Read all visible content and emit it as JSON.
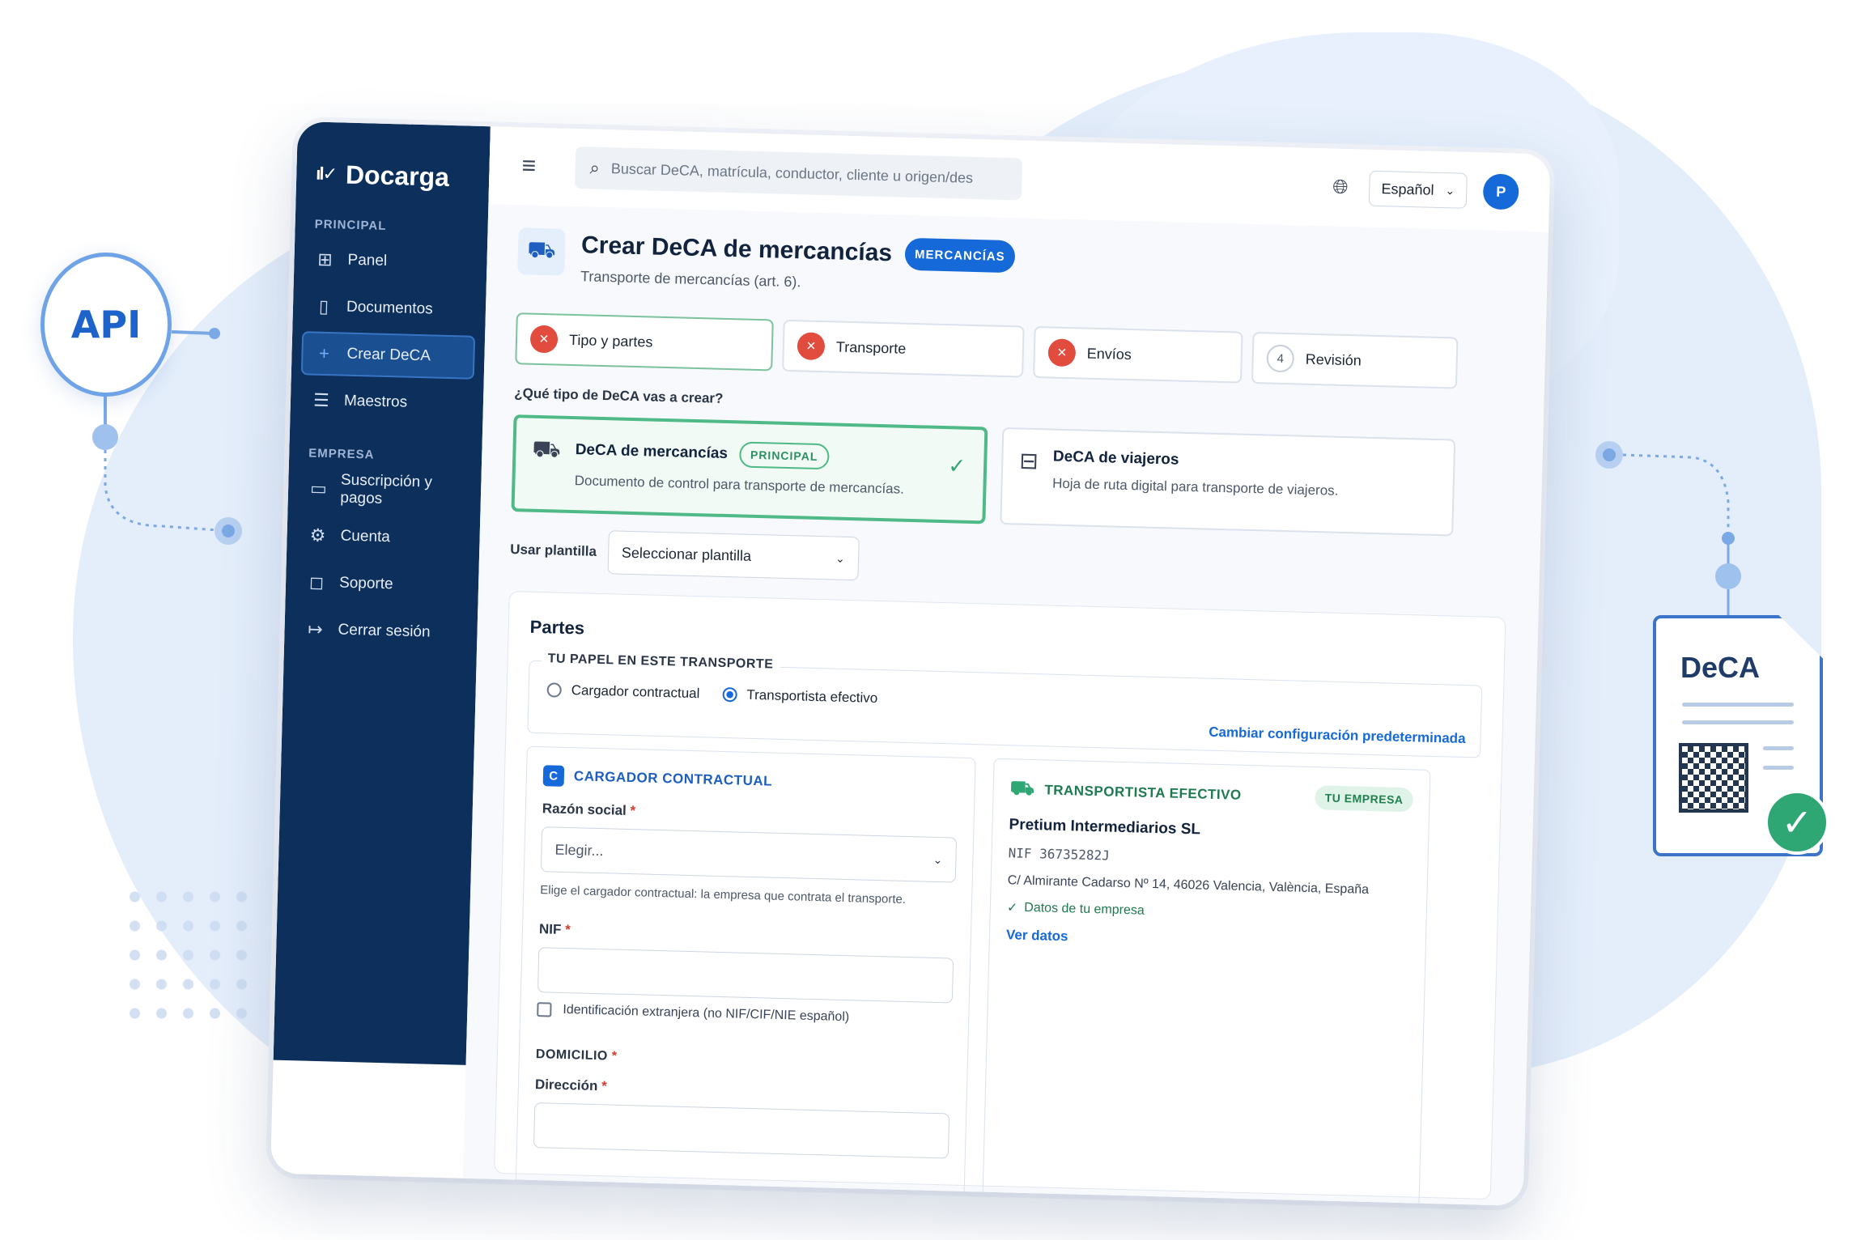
{
  "brand": {
    "name": "Docarga"
  },
  "sidebar": {
    "sections": [
      {
        "label": "PRINCIPAL"
      },
      {
        "label": "EMPRESA"
      }
    ],
    "items": [
      {
        "label": "Panel"
      },
      {
        "label": "Documentos"
      },
      {
        "label": "Crear DeCA"
      },
      {
        "label": "Maestros"
      },
      {
        "label": "Suscripción y pagos"
      },
      {
        "label": "Cuenta"
      },
      {
        "label": "Soporte"
      },
      {
        "label": "Cerrar sesión"
      }
    ]
  },
  "topbar": {
    "search_placeholder": "Buscar DeCA, matrícula, conductor, cliente u origen/des",
    "language": "Español",
    "avatar_initial": "P"
  },
  "header": {
    "title": "Crear DeCA de mercancías",
    "badge": "MERCANCÍAS",
    "subtitle": "Transporte de mercancías (art. 6)."
  },
  "steps": [
    {
      "label": "Tipo y partes"
    },
    {
      "label": "Transporte"
    },
    {
      "label": "Envíos"
    },
    {
      "num": "4",
      "label": "Revisión"
    }
  ],
  "type_question": "¿Qué tipo de DeCA vas a crear?",
  "type_cards": [
    {
      "title": "DeCA de mercancías",
      "badge": "PRINCIPAL",
      "desc": "Documento de control para transporte de mercancías."
    },
    {
      "title": "DeCA de viajeros",
      "desc": "Hoja de ruta digital para transporte de viajeros."
    }
  ],
  "template": {
    "label": "Usar plantilla",
    "value": "Seleccionar plantilla"
  },
  "partes": {
    "title": "Partes",
    "papel": {
      "legend": "TU PAPEL EN ESTE TRANSPORTE",
      "options": [
        "Cargador contractual",
        "Transportista efectivo"
      ],
      "selected": "Transportista efectivo",
      "change_link": "Cambiar configuración predeterminada"
    },
    "cargador": {
      "badge": "C",
      "title": "CARGADOR CONTRACTUAL",
      "razon_label": "Razón social",
      "razon_value": "Elegir...",
      "hint": "Elige el cargador contractual: la empresa que contrata el transporte.",
      "nif_label": "NIF",
      "extranjera": "Identificación extranjera (no NIF/CIF/NIE español)",
      "domicilio": "DOMICILIO",
      "direccion": "Dirección"
    },
    "transportista": {
      "title": "TRANSPORTISTA EFECTIVO",
      "badge": "TU EMPRESA",
      "name": "Pretium Intermediarios SL",
      "nif": "NIF  36735282J",
      "address": "C/ Almirante Cadarso Nº 14, 46026 Valencia, València, España",
      "ok": "Datos de tu empresa",
      "link": "Ver datos"
    }
  },
  "decor": {
    "api": "API",
    "doc": "DeCA"
  },
  "colors": {
    "sidebar": "#0d2f5c",
    "accent": "#1669d9",
    "success": "#2fa774",
    "error": "#e14c3e"
  },
  "icons": [
    "hamburger-icon",
    "search-icon",
    "globe-icon",
    "truck-icon",
    "bus-icon",
    "grid-icon",
    "document-icon",
    "plus-icon",
    "list-icon",
    "card-icon",
    "gear-icon",
    "chat-icon",
    "logout-icon",
    "check-icon",
    "close-icon",
    "chevron-down-icon"
  ]
}
